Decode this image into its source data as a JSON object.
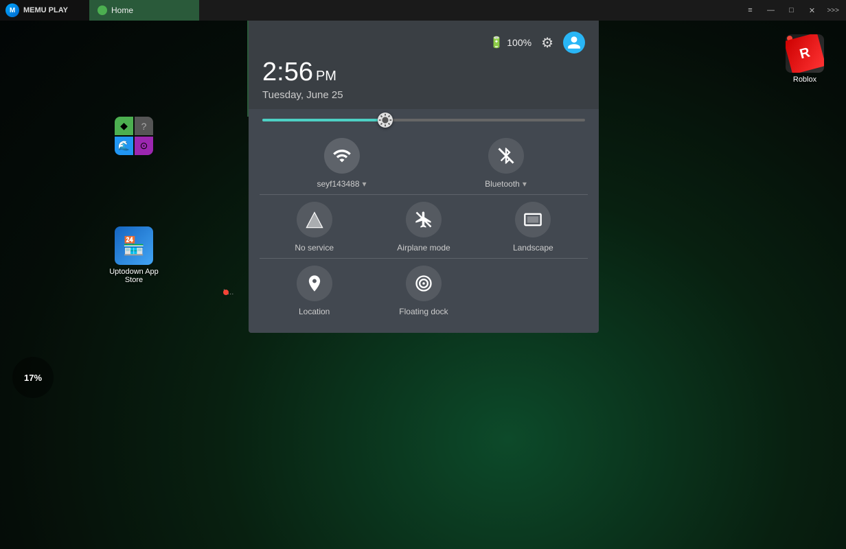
{
  "app": {
    "title": "MEmu Play",
    "tab": "Home"
  },
  "taskbar": {
    "logo": "M",
    "logo_label": "MEMU PLAY",
    "tab_title": "Home",
    "controls": {
      "menu": "≡",
      "minimize": "—",
      "restore": "□",
      "close": "✕",
      "more": ">>>"
    }
  },
  "header": {
    "battery_pct": "100%",
    "time": "2:56",
    "ampm": "PM",
    "date": "Tuesday, June 25"
  },
  "tiles": {
    "wifi_label": "seyf143488",
    "bluetooth_label": "Bluetooth",
    "no_service_label": "No service",
    "airplane_label": "Airplane mode",
    "landscape_label": "Landscape",
    "location_label": "Location",
    "floating_dock_label": "Floating dock"
  },
  "desktop_icons": {
    "roblox_label": "Roblox",
    "store_label": "Uptodown App Store"
  },
  "weather": {
    "value": "17%"
  }
}
